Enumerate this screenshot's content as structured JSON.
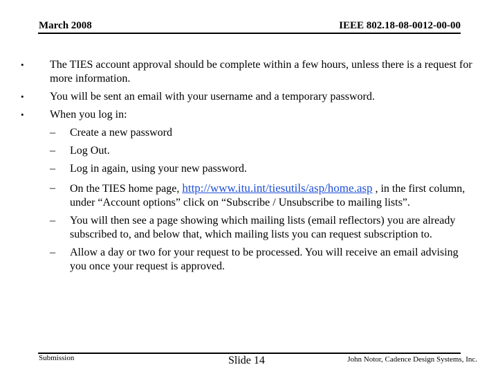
{
  "header": {
    "date": "March 2008",
    "doc_id": "IEEE 802.18-08-0012-00-00"
  },
  "bullets": [
    {
      "text": "The TIES account approval should be complete within a few hours, unless there is a request for more information."
    },
    {
      "text": "You will be sent an email with your username and a temporary password."
    },
    {
      "text": "When you log in:"
    }
  ],
  "sub_bullets": [
    {
      "text": "Create a new password"
    },
    {
      "text": "Log Out."
    },
    {
      "text": "Log in again, using your new password."
    },
    {
      "pre": "On the TIES home page, ",
      "link": "http://www.itu.int/tiesutils/asp/home.asp",
      "post": " , in the first column, under “Account options” click on “Subscribe / Unsubscribe to mailing lists”."
    },
    {
      "text": "You will then see a page showing which mailing lists (email reflectors) you are already subscribed to, and below that, which mailing lists you can request subscription to."
    },
    {
      "text": "Allow a day or two for your request to be processed. You will receive an email advising you once your request is approved."
    }
  ],
  "symbols": {
    "bullet": "•",
    "dash": "–"
  },
  "colors": {
    "link": "#1f4fd6"
  },
  "footer": {
    "left": "Submission",
    "center": "Slide 14",
    "right": "John Notor, Cadence Design Systems, Inc."
  }
}
